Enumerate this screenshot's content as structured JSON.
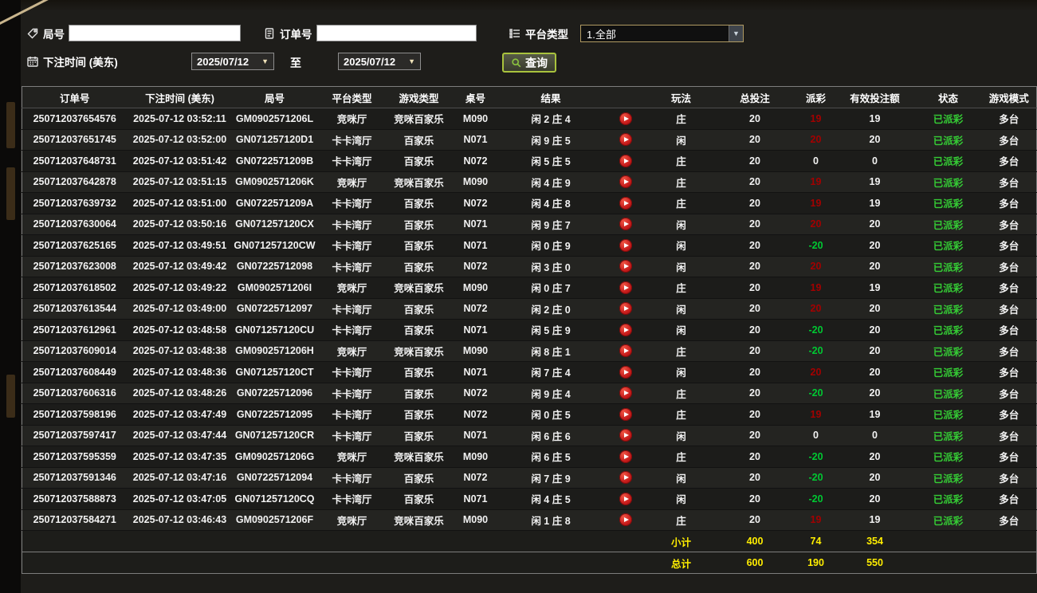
{
  "colors": {
    "win": "#a30000",
    "loss": "#00c832",
    "zero": "#f2f2f2",
    "status": "#35cc35",
    "totals": "#ffee00"
  },
  "icons": {
    "round": "tag-icon",
    "order": "document-icon",
    "platform": "list-icon",
    "time": "calendar-icon",
    "query": "search-icon",
    "play": "play-icon",
    "dropdown": "chevron-down-icon"
  },
  "filters": {
    "round": {
      "label": "局号",
      "value": ""
    },
    "order": {
      "label": "订单号",
      "value": ""
    },
    "platform": {
      "label": "平台类型",
      "value": "1.全部"
    },
    "bet_time": {
      "label": "下注时间 (美东)",
      "from": "2025/07/12",
      "to_label": "至",
      "to": "2025/07/12"
    },
    "query_button": "查询"
  },
  "table": {
    "headers": [
      "订单号",
      "下注时间 (美东)",
      "局号",
      "平台类型",
      "游戏类型",
      "桌号",
      "结果",
      "",
      "玩法",
      "总投注",
      "派彩",
      "有效投注额",
      "状态",
      "游戏模式"
    ],
    "rows": [
      {
        "order_no": "250712037654576",
        "bet_time": "2025-07-12 03:52:11",
        "round_no": "GM0902571206L",
        "platform": "竞咪厅",
        "game_type": "竞咪百家乐",
        "table_no": "M090",
        "result": "闲 2 庄 4",
        "play": "庄",
        "total_bet": "20",
        "payout": "19",
        "payout_kind": "win",
        "valid_bet": "19",
        "status": "已派彩",
        "mode": "多台"
      },
      {
        "order_no": "250712037651745",
        "bet_time": "2025-07-12 03:52:00",
        "round_no": "GN071257120D1",
        "platform": "卡卡湾厅",
        "game_type": "百家乐",
        "table_no": "N071",
        "result": "闲 9 庄 5",
        "play": "闲",
        "total_bet": "20",
        "payout": "20",
        "payout_kind": "win",
        "valid_bet": "20",
        "status": "已派彩",
        "mode": "多台"
      },
      {
        "order_no": "250712037648731",
        "bet_time": "2025-07-12 03:51:42",
        "round_no": "GN0722571209B",
        "platform": "卡卡湾厅",
        "game_type": "百家乐",
        "table_no": "N072",
        "result": "闲 5 庄 5",
        "play": "庄",
        "total_bet": "20",
        "payout": "0",
        "payout_kind": "zero",
        "valid_bet": "0",
        "status": "已派彩",
        "mode": "多台"
      },
      {
        "order_no": "250712037642878",
        "bet_time": "2025-07-12 03:51:15",
        "round_no": "GM0902571206K",
        "platform": "竞咪厅",
        "game_type": "竞咪百家乐",
        "table_no": "M090",
        "result": "闲 4 庄 9",
        "play": "庄",
        "total_bet": "20",
        "payout": "19",
        "payout_kind": "win",
        "valid_bet": "19",
        "status": "已派彩",
        "mode": "多台"
      },
      {
        "order_no": "250712037639732",
        "bet_time": "2025-07-12 03:51:00",
        "round_no": "GN0722571209A",
        "platform": "卡卡湾厅",
        "game_type": "百家乐",
        "table_no": "N072",
        "result": "闲 4 庄 8",
        "play": "庄",
        "total_bet": "20",
        "payout": "19",
        "payout_kind": "win",
        "valid_bet": "19",
        "status": "已派彩",
        "mode": "多台"
      },
      {
        "order_no": "250712037630064",
        "bet_time": "2025-07-12 03:50:16",
        "round_no": "GN071257120CX",
        "platform": "卡卡湾厅",
        "game_type": "百家乐",
        "table_no": "N071",
        "result": "闲 9 庄 7",
        "play": "闲",
        "total_bet": "20",
        "payout": "20",
        "payout_kind": "win",
        "valid_bet": "20",
        "status": "已派彩",
        "mode": "多台"
      },
      {
        "order_no": "250712037625165",
        "bet_time": "2025-07-12 03:49:51",
        "round_no": "GN071257120CW",
        "platform": "卡卡湾厅",
        "game_type": "百家乐",
        "table_no": "N071",
        "result": "闲 0 庄 9",
        "play": "闲",
        "total_bet": "20",
        "payout": "-20",
        "payout_kind": "loss",
        "valid_bet": "20",
        "status": "已派彩",
        "mode": "多台"
      },
      {
        "order_no": "250712037623008",
        "bet_time": "2025-07-12 03:49:42",
        "round_no": "GN07225712098",
        "platform": "卡卡湾厅",
        "game_type": "百家乐",
        "table_no": "N072",
        "result": "闲 3 庄 0",
        "play": "闲",
        "total_bet": "20",
        "payout": "20",
        "payout_kind": "win",
        "valid_bet": "20",
        "status": "已派彩",
        "mode": "多台"
      },
      {
        "order_no": "250712037618502",
        "bet_time": "2025-07-12 03:49:22",
        "round_no": "GM0902571206I",
        "platform": "竞咪厅",
        "game_type": "竞咪百家乐",
        "table_no": "M090",
        "result": "闲 0 庄 7",
        "play": "庄",
        "total_bet": "20",
        "payout": "19",
        "payout_kind": "win",
        "valid_bet": "19",
        "status": "已派彩",
        "mode": "多台"
      },
      {
        "order_no": "250712037613544",
        "bet_time": "2025-07-12 03:49:00",
        "round_no": "GN07225712097",
        "platform": "卡卡湾厅",
        "game_type": "百家乐",
        "table_no": "N072",
        "result": "闲 2 庄 0",
        "play": "闲",
        "total_bet": "20",
        "payout": "20",
        "payout_kind": "win",
        "valid_bet": "20",
        "status": "已派彩",
        "mode": "多台"
      },
      {
        "order_no": "250712037612961",
        "bet_time": "2025-07-12 03:48:58",
        "round_no": "GN071257120CU",
        "platform": "卡卡湾厅",
        "game_type": "百家乐",
        "table_no": "N071",
        "result": "闲 5 庄 9",
        "play": "闲",
        "total_bet": "20",
        "payout": "-20",
        "payout_kind": "loss",
        "valid_bet": "20",
        "status": "已派彩",
        "mode": "多台"
      },
      {
        "order_no": "250712037609014",
        "bet_time": "2025-07-12 03:48:38",
        "round_no": "GM0902571206H",
        "platform": "竞咪厅",
        "game_type": "竞咪百家乐",
        "table_no": "M090",
        "result": "闲 8 庄 1",
        "play": "庄",
        "total_bet": "20",
        "payout": "-20",
        "payout_kind": "loss",
        "valid_bet": "20",
        "status": "已派彩",
        "mode": "多台"
      },
      {
        "order_no": "250712037608449",
        "bet_time": "2025-07-12 03:48:36",
        "round_no": "GN071257120CT",
        "platform": "卡卡湾厅",
        "game_type": "百家乐",
        "table_no": "N071",
        "result": "闲 7 庄 4",
        "play": "闲",
        "total_bet": "20",
        "payout": "20",
        "payout_kind": "win",
        "valid_bet": "20",
        "status": "已派彩",
        "mode": "多台"
      },
      {
        "order_no": "250712037606316",
        "bet_time": "2025-07-12 03:48:26",
        "round_no": "GN07225712096",
        "platform": "卡卡湾厅",
        "game_type": "百家乐",
        "table_no": "N072",
        "result": "闲 9 庄 4",
        "play": "庄",
        "total_bet": "20",
        "payout": "-20",
        "payout_kind": "loss",
        "valid_bet": "20",
        "status": "已派彩",
        "mode": "多台"
      },
      {
        "order_no": "250712037598196",
        "bet_time": "2025-07-12 03:47:49",
        "round_no": "GN07225712095",
        "platform": "卡卡湾厅",
        "game_type": "百家乐",
        "table_no": "N072",
        "result": "闲 0 庄 5",
        "play": "庄",
        "total_bet": "20",
        "payout": "19",
        "payout_kind": "win",
        "valid_bet": "19",
        "status": "已派彩",
        "mode": "多台"
      },
      {
        "order_no": "250712037597417",
        "bet_time": "2025-07-12 03:47:44",
        "round_no": "GN071257120CR",
        "platform": "卡卡湾厅",
        "game_type": "百家乐",
        "table_no": "N071",
        "result": "闲 6 庄 6",
        "play": "闲",
        "total_bet": "20",
        "payout": "0",
        "payout_kind": "zero",
        "valid_bet": "0",
        "status": "已派彩",
        "mode": "多台"
      },
      {
        "order_no": "250712037595359",
        "bet_time": "2025-07-12 03:47:35",
        "round_no": "GM0902571206G",
        "platform": "竞咪厅",
        "game_type": "竞咪百家乐",
        "table_no": "M090",
        "result": "闲 6 庄 5",
        "play": "庄",
        "total_bet": "20",
        "payout": "-20",
        "payout_kind": "loss",
        "valid_bet": "20",
        "status": "已派彩",
        "mode": "多台"
      },
      {
        "order_no": "250712037591346",
        "bet_time": "2025-07-12 03:47:16",
        "round_no": "GN07225712094",
        "platform": "卡卡湾厅",
        "game_type": "百家乐",
        "table_no": "N072",
        "result": "闲 7 庄 9",
        "play": "闲",
        "total_bet": "20",
        "payout": "-20",
        "payout_kind": "loss",
        "valid_bet": "20",
        "status": "已派彩",
        "mode": "多台"
      },
      {
        "order_no": "250712037588873",
        "bet_time": "2025-07-12 03:47:05",
        "round_no": "GN071257120CQ",
        "platform": "卡卡湾厅",
        "game_type": "百家乐",
        "table_no": "N071",
        "result": "闲 4 庄 5",
        "play": "闲",
        "total_bet": "20",
        "payout": "-20",
        "payout_kind": "loss",
        "valid_bet": "20",
        "status": "已派彩",
        "mode": "多台"
      },
      {
        "order_no": "250712037584271",
        "bet_time": "2025-07-12 03:46:43",
        "round_no": "GM0902571206F",
        "platform": "竞咪厅",
        "game_type": "竞咪百家乐",
        "table_no": "M090",
        "result": "闲 1 庄 8",
        "play": "庄",
        "total_bet": "20",
        "payout": "19",
        "payout_kind": "win",
        "valid_bet": "19",
        "status": "已派彩",
        "mode": "多台"
      }
    ],
    "subtotal": {
      "label": "小计",
      "total_bet": "400",
      "payout": "74",
      "valid_bet": "354"
    },
    "total": {
      "label": "总计",
      "total_bet": "600",
      "payout": "190",
      "valid_bet": "550"
    }
  }
}
